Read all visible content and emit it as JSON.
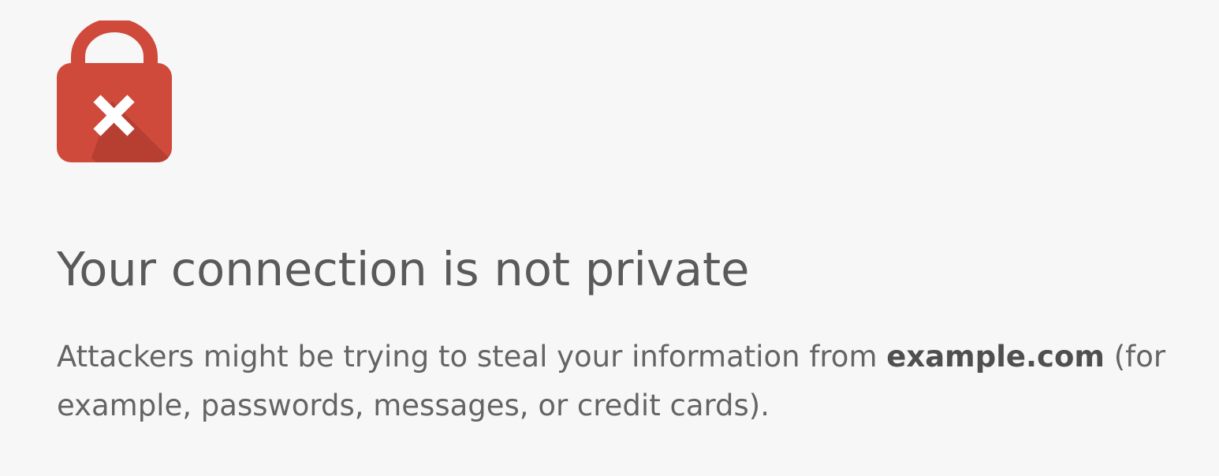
{
  "interstitial": {
    "icon": "lock-error-icon",
    "icon_color": "#cf4a3b",
    "heading": "Your connection is not private",
    "message": {
      "before": "Attackers might be trying to steal your information from ",
      "hostname": "example.com",
      "after": " (for example, passwords, messages, or credit cards)."
    }
  }
}
